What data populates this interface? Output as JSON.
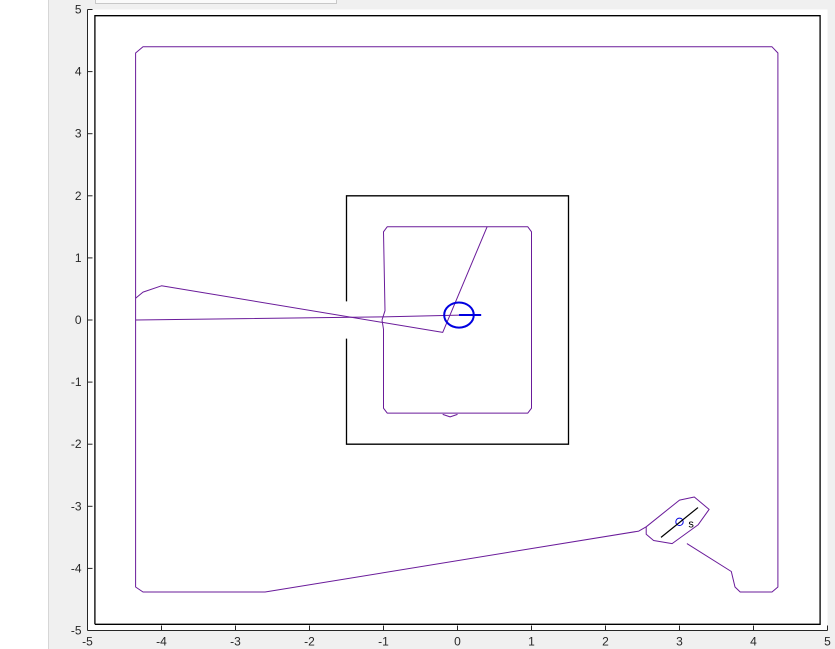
{
  "figure": {
    "background": "#f0f0f0",
    "axes_background": "#ffffff",
    "trajectory_color": "#6a1b9a",
    "wall_color": "#000000",
    "robot_color": "#0000e0"
  },
  "chart_data": {
    "type": "line",
    "title": "",
    "xlabel": "",
    "ylabel": "",
    "xlim": [
      -5,
      5
    ],
    "ylim": [
      -5,
      5
    ],
    "xticks": [
      -5,
      -4,
      -3,
      -2,
      -1,
      0,
      1,
      2,
      3,
      4,
      5
    ],
    "yticks": [
      -5,
      -4,
      -3,
      -2,
      -1,
      0,
      1,
      2,
      3,
      4,
      5
    ],
    "grid": false,
    "walls": [
      {
        "points": [
          [
            -4.9,
            -4.9
          ],
          [
            4.9,
            -4.9
          ],
          [
            4.9,
            4.9
          ],
          [
            -4.9,
            4.9
          ],
          [
            -4.9,
            -4.9
          ]
        ]
      },
      {
        "points": [
          [
            -1.5,
            0.3
          ],
          [
            -1.5,
            2.0
          ],
          [
            1.5,
            2.0
          ],
          [
            1.5,
            -2.0
          ],
          [
            -1.5,
            -2.0
          ],
          [
            -1.5,
            -0.3
          ]
        ]
      }
    ],
    "series": [
      {
        "points": [
          [
            3.1,
            -3.6
          ],
          [
            3.7,
            -4.05
          ],
          [
            3.75,
            -4.3
          ],
          [
            3.82,
            -4.38
          ],
          [
            4.25,
            -4.38
          ],
          [
            4.33,
            -4.3
          ],
          [
            4.33,
            4.3
          ],
          [
            4.25,
            4.4
          ],
          [
            -4.25,
            4.4
          ],
          [
            -4.35,
            4.3
          ],
          [
            -4.35,
            -4.3
          ],
          [
            -4.25,
            -4.38
          ],
          [
            -2.6,
            -4.38
          ],
          [
            2.45,
            -3.4
          ],
          [
            2.55,
            -3.33
          ]
        ]
      },
      {
        "points": [
          [
            2.55,
            -3.33
          ],
          [
            3.0,
            -2.9
          ],
          [
            3.2,
            -2.85
          ],
          [
            3.4,
            -3.05
          ],
          [
            3.25,
            -3.3
          ],
          [
            2.9,
            -3.6
          ],
          [
            2.65,
            -3.55
          ],
          [
            2.55,
            -3.45
          ],
          [
            2.55,
            -3.33
          ]
        ]
      },
      {
        "points": [
          [
            -4.35,
            0.0
          ],
          [
            -1.0,
            0.05
          ],
          [
            0.1,
            0.08
          ]
        ]
      },
      {
        "points": [
          [
            -4.35,
            0.35
          ],
          [
            -4.25,
            0.45
          ],
          [
            -4.0,
            0.55
          ],
          [
            -0.2,
            -0.2
          ],
          [
            0.4,
            1.5
          ]
        ]
      },
      {
        "points": [
          [
            -1.02,
            0.0
          ],
          [
            -0.98,
            0.15
          ],
          [
            -1.0,
            1.42
          ],
          [
            -0.95,
            1.5
          ],
          [
            0.95,
            1.5
          ],
          [
            1.0,
            1.42
          ],
          [
            1.0,
            -1.42
          ],
          [
            0.95,
            -1.5
          ],
          [
            -0.95,
            -1.5
          ],
          [
            -1.0,
            -1.42
          ],
          [
            -1.0,
            -0.15
          ],
          [
            -1.02,
            0.0
          ]
        ]
      },
      {
        "points": [
          [
            -0.2,
            -1.52
          ],
          [
            -0.1,
            -1.56
          ],
          [
            0.0,
            -1.52
          ]
        ]
      }
    ],
    "markers": [
      {
        "kind": "robot-circle",
        "x": 0.02,
        "y": 0.08,
        "radius": 0.2
      },
      {
        "kind": "heading-line",
        "x1": 0.02,
        "y1": 0.08,
        "x2": 0.32,
        "y2": 0.08
      },
      {
        "kind": "start-circle",
        "x": 3.0,
        "y": -3.25,
        "radius": 0.05
      },
      {
        "kind": "start-line",
        "x1": 2.75,
        "y1": -3.5,
        "x2": 3.25,
        "y2": -3.02
      },
      {
        "kind": "start-label",
        "x": 3.12,
        "y": -3.28,
        "text": "s"
      }
    ]
  }
}
